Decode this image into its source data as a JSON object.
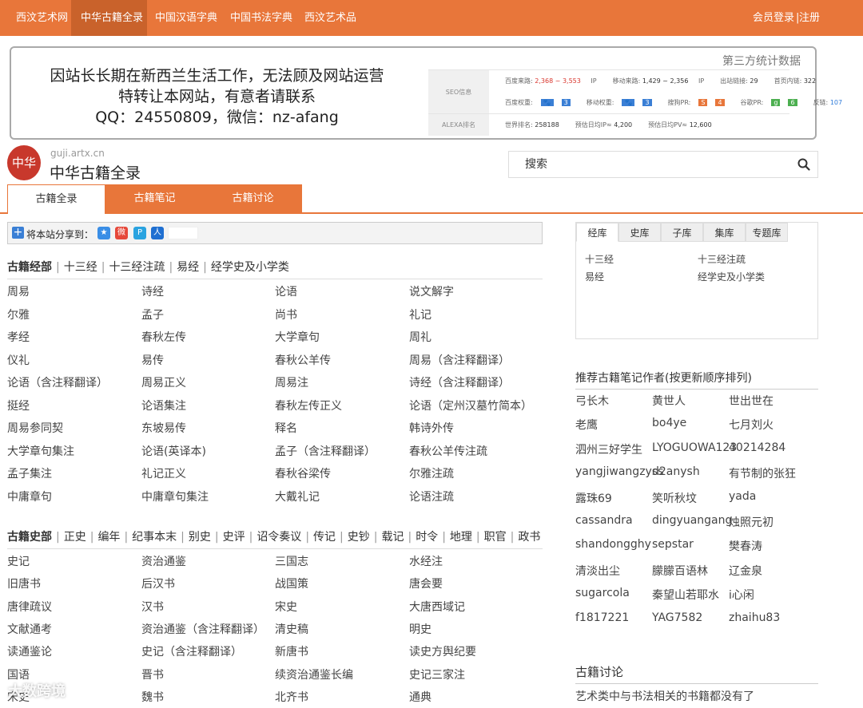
{
  "topnav": {
    "items": [
      "西汶艺术网",
      "中华古籍全录",
      "中国汉语字典",
      "中国书法字典",
      "西汶艺术品"
    ],
    "active_index": 1,
    "login": "会员登录",
    "register": "注册",
    "sep": "|"
  },
  "ad": {
    "line1": "因站长长期在新西兰生活工作，无法顾及网站运营",
    "line2": "特转让本网站，有意者请联系",
    "line3": "QQ：24550809，微信：nz-afang",
    "stats_title": "第三方统计数据",
    "seo_label": "SEO信息",
    "alexa_label": "ALEXA排名",
    "baidu_come_label": "百度来路:",
    "baidu_come_value": "2,368 ~ 3,553",
    "baidu_come_unit": "IP",
    "mobile_come_label": "移动来路:",
    "mobile_come_value": "1,429 ~ 2,356",
    "mobile_come_unit": "IP",
    "out_links_label": "出站链接:",
    "out_links_value": "29",
    "inner_links_label": "首页内链:",
    "inner_links_value": "322",
    "baidu_weight_label": "百度权重:",
    "baidu_weight_value": "3",
    "mobile_weight_label": "移动权重:",
    "mobile_weight_value": "3",
    "sogou_pr_label": "搜狗PR:",
    "sogou_pr_value": "4",
    "google_pr_label": "谷歌PR:",
    "google_pr_value": "6",
    "backlinks_label": "反链:",
    "backlinks_value": "107",
    "world_rank_label": "世界排名:",
    "world_rank_value": "258188",
    "daily_ip_label": "预估日均IP≈",
    "daily_ip_value": "4,200",
    "daily_pv_label": "预估日均PV≈",
    "daily_pv_value": "12,600"
  },
  "logo": {
    "seal_text": "中华",
    "domain": "guji.artx.cn",
    "name": "中华古籍全录"
  },
  "search": {
    "placeholder": "搜索"
  },
  "tabs": [
    "古籍全录",
    "古籍笔记",
    "古籍讨论"
  ],
  "share": {
    "label": "将本站分享到："
  },
  "section_jing": {
    "title": "古籍经部",
    "subs": [
      "十三经",
      "十三经注疏",
      "易经",
      "经学史及小学类"
    ],
    "books": [
      "周易",
      "诗经",
      "论语",
      "说文解字",
      "尔雅",
      "孟子",
      "尚书",
      "礼记",
      "孝经",
      "春秋左传",
      "大学章句",
      "周礼",
      "仪礼",
      "易传",
      "春秋公羊传",
      "周易（含注释翻译）",
      "论语（含注释翻译）",
      "周易正义",
      "周易注",
      "诗经（含注释翻译）",
      "挺经",
      "论语集注",
      "春秋左传正义",
      "论语（定州汉墓竹简本）",
      "周易参同契",
      "东坡易传",
      "释名",
      "韩诗外传",
      "大学章句集注",
      "论语(英译本)",
      "孟子（含注释翻译）",
      "春秋公羊传注疏",
      "孟子集注",
      "礼记正义",
      "春秋谷梁传",
      "尔雅注疏",
      "中庸章句",
      "中庸章句集注",
      "大戴礼记",
      "论语注疏"
    ]
  },
  "section_shi": {
    "title": "古籍史部",
    "subs": [
      "正史",
      "编年",
      "纪事本末",
      "别史",
      "史评",
      "诏令奏议",
      "传记",
      "史钞",
      "载记",
      "时令",
      "地理",
      "职官",
      "政书"
    ],
    "books": [
      "史记",
      "资治通鉴",
      "三国志",
      "水经注",
      "旧唐书",
      "后汉书",
      "战国策",
      "唐会要",
      "唐律疏议",
      "汉书",
      "宋史",
      "大唐西域记",
      "文献通考",
      "资治通鉴（含注释翻译）",
      "清史稿",
      "明史",
      "读通鉴论",
      "史记（含注释翻译）",
      "新唐书",
      "读史方舆纪要",
      "国语",
      "晋书",
      "续资治通鉴长编",
      "史记三家注",
      "宋史",
      "魏书",
      "北齐书",
      "通典"
    ]
  },
  "lib_panel": {
    "tabs": [
      "经库",
      "史库",
      "子库",
      "集库",
      "专题库"
    ],
    "active_index": 0,
    "items": [
      "十三经",
      "十三经注疏",
      "易经",
      "经学史及小学类"
    ]
  },
  "authors": {
    "title": "推荐古籍笔记作者(按更新顺序排列)",
    "names": [
      "弓长木",
      "黄世人",
      "世出世在",
      "老鹰",
      "bo4ye",
      "七月刘火",
      "泗州三好学生",
      "LYOGUOWA123",
      "40214284",
      "yangjiwangzyss",
      "d2anysh",
      "有节制的张狂",
      "露珠69",
      "笑听秋坟",
      "yada",
      "cassandra",
      "dingyuangang",
      "烛照元初",
      "shandongghy",
      "sepstar",
      "樊春涛",
      "清淡出尘",
      "朦朦百语林",
      "辽金泉",
      "sugarcola",
      "秦望山若耶水",
      "i心闲",
      "f1817221",
      "YAG7582",
      "zhaihu83"
    ]
  },
  "discussion": {
    "title": "古籍讨论",
    "item": "艺术类中与书法相关的书籍都没有了"
  },
  "watermark": "大数跨境"
}
